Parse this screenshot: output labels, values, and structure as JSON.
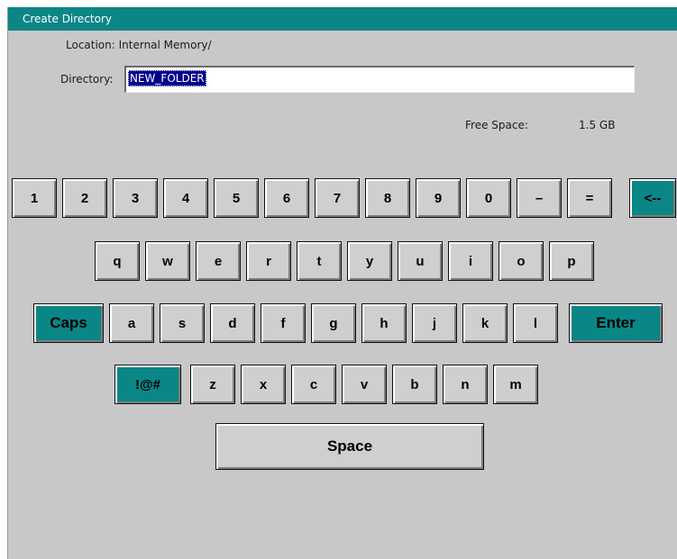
{
  "window": {
    "title": "Create Directory",
    "location_text": "Location: Internal Memory/",
    "directory_label": "Directory:",
    "directory_value": "NEW_FOLDER",
    "free_space_label": "Free Space:",
    "free_space_value": "1.5 GB"
  },
  "keyboard": {
    "row1": [
      "1",
      "2",
      "3",
      "4",
      "5",
      "6",
      "7",
      "8",
      "9",
      "0",
      "–",
      "=",
      "<--"
    ],
    "row2": [
      "q",
      "w",
      "e",
      "r",
      "t",
      "y",
      "u",
      "i",
      "o",
      "p"
    ],
    "row3": [
      "Caps",
      "a",
      "s",
      "d",
      "f",
      "g",
      "h",
      "j",
      "k",
      "l",
      "Enter"
    ],
    "row4": [
      "!@#",
      "z",
      "x",
      "c",
      "v",
      "b",
      "n",
      "m"
    ],
    "space_label": "Space"
  },
  "colors": {
    "title_bar": "#0b8686",
    "teal_key": "#0b8686",
    "background": "#c8c8c8",
    "selection": "#00008b"
  }
}
